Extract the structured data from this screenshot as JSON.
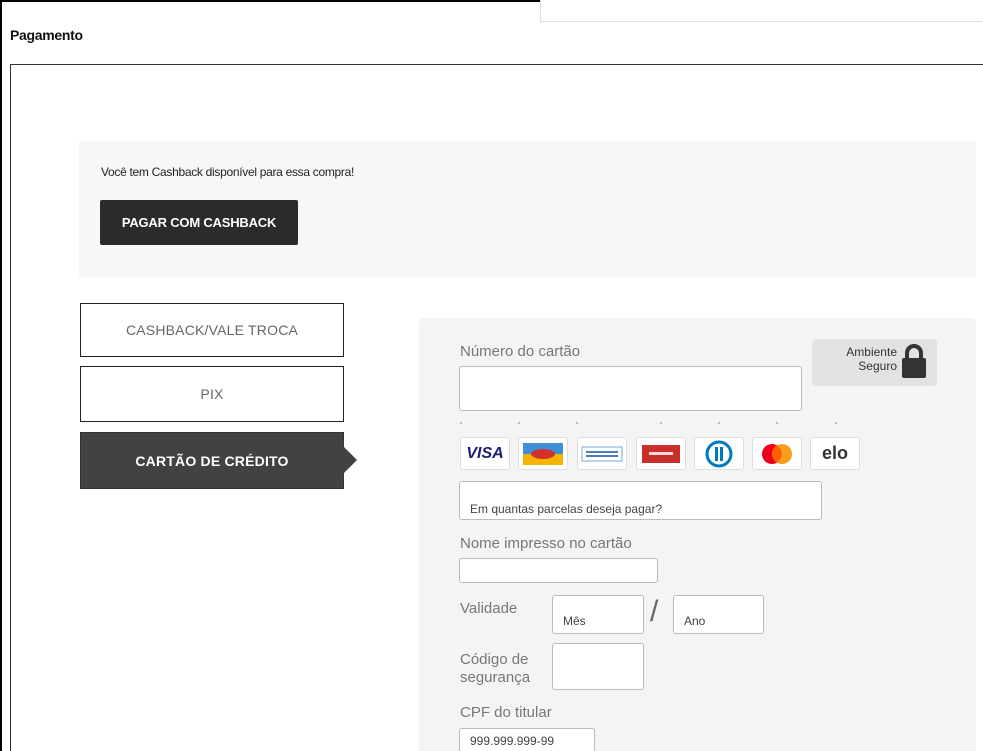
{
  "page": {
    "title": "Pagamento"
  },
  "cashback": {
    "message": "Você tem Cashback disponível para essa compra!",
    "button_label": "PAGAR COM CASHBACK"
  },
  "payment_tabs": [
    {
      "label": "CASHBACK/VALE TROCA",
      "active": false
    },
    {
      "label": "PIX",
      "active": false
    },
    {
      "label": "CARTÃO DE CRÉDITO",
      "active": true
    }
  ],
  "credit_card_form": {
    "card_number_label": "Número do cartão",
    "card_number_value": "",
    "secure_badge": {
      "line1": "Ambiente",
      "line2": "Seguro",
      "icon": "lock-icon"
    },
    "card_brands": [
      "visa",
      "hipercard",
      "american-express",
      "hipercard-red",
      "diners",
      "mastercard",
      "elo"
    ],
    "brand_text": {
      "visa": "VISA",
      "elo": "elo"
    },
    "installments_placeholder": "Em quantas parcelas deseja pagar?",
    "name_label": "Nome impresso no cartão",
    "name_value": "",
    "expiry_label": "Validade",
    "expiry_month_placeholder": "Mês",
    "expiry_year_placeholder": "Ano",
    "expiry_separator": "/",
    "cvv_label_line1": "Código de",
    "cvv_label_line2": "segurança",
    "cpf_label": "CPF do titular",
    "cpf_placeholder": "999.999.999-99"
  },
  "colors": {
    "dark_button": "#2b2b2b",
    "active_tab": "#424242",
    "form_background": "#f4f4f4"
  }
}
